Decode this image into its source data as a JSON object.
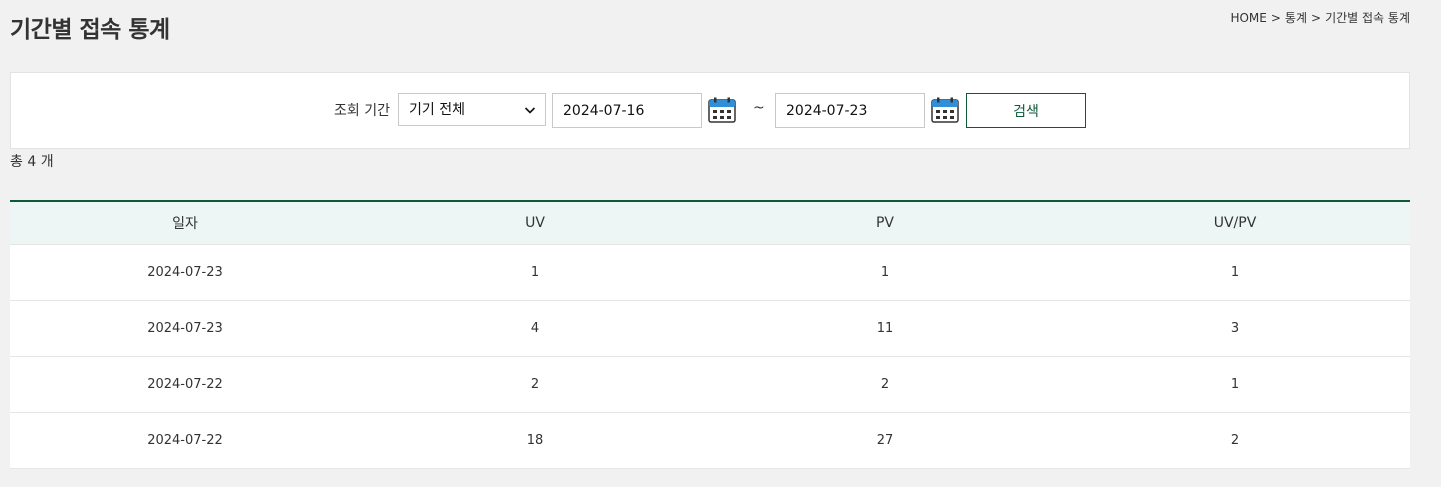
{
  "page": {
    "title": "기간별 접속 통계"
  },
  "breadcrumb": {
    "items": [
      "HOME",
      "통계",
      "기간별 접속 통계"
    ],
    "separator": ">"
  },
  "search": {
    "label": "조회 기간",
    "device_select": {
      "selected": "기기 전체"
    },
    "start_date": "2024-07-16",
    "end_date": "2024-07-23",
    "range_separator": "~",
    "button_label": "검색"
  },
  "total": {
    "text": "총 4 개"
  },
  "table": {
    "headers": [
      "일자",
      "UV",
      "PV",
      "UV/PV"
    ],
    "rows": [
      [
        "2024-07-23",
        "1",
        "1",
        "1"
      ],
      [
        "2024-07-23",
        "4",
        "11",
        "3"
      ],
      [
        "2024-07-22",
        "2",
        "2",
        "1"
      ],
      [
        "2024-07-22",
        "18",
        "27",
        "2"
      ]
    ]
  },
  "colors": {
    "accent": "#0d5a3a",
    "header_bg": "#edf5f5",
    "page_bg": "#f1f1f1",
    "calendar_blue": "#2f8fd8"
  },
  "icons": {
    "calendar": "calendar-icon",
    "dropdown": "chevron-down-icon"
  }
}
